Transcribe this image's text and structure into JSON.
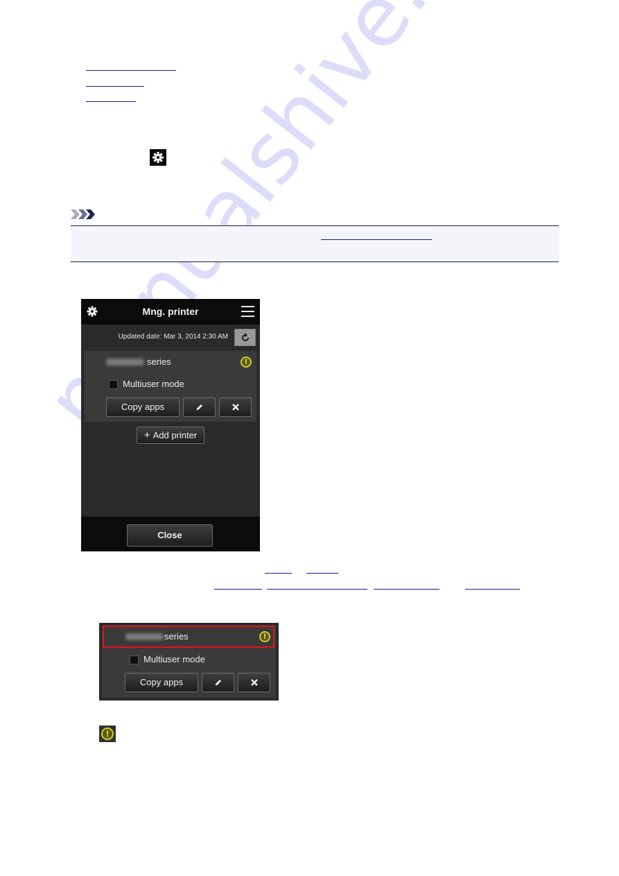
{
  "links_top": [
    {
      "text": ""
    },
    {
      "text": ""
    },
    {
      "text": ""
    }
  ],
  "inline_icons": {
    "gear": "gear-icon",
    "warning": "warning-icon"
  },
  "note": {
    "icon": "note-chevrons-icon",
    "link_text": ""
  },
  "app": {
    "title": "Mng. printer",
    "updated_label": "Updated date: Mar 3, 2014 2:30 AM",
    "printer": {
      "name_suffix": "series",
      "multiuser_label": "Multiuser mode",
      "multiuser_checked": false,
      "copy_apps_label": "Copy apps",
      "status": "warning"
    },
    "add_printer_label": "Add printer",
    "close_label": "Close"
  },
  "crop": {
    "name_suffix": "series",
    "multiuser_label": "Multiuser mode",
    "copy_apps_label": "Copy apps",
    "highlight_color": "#e0141e"
  },
  "colors": {
    "link": "#1a1a8c",
    "warning_ring": "#cfcc3a",
    "app_header": "#0b0b0b",
    "app_body": "#2a2a2a"
  },
  "watermark": "manualshive.com"
}
